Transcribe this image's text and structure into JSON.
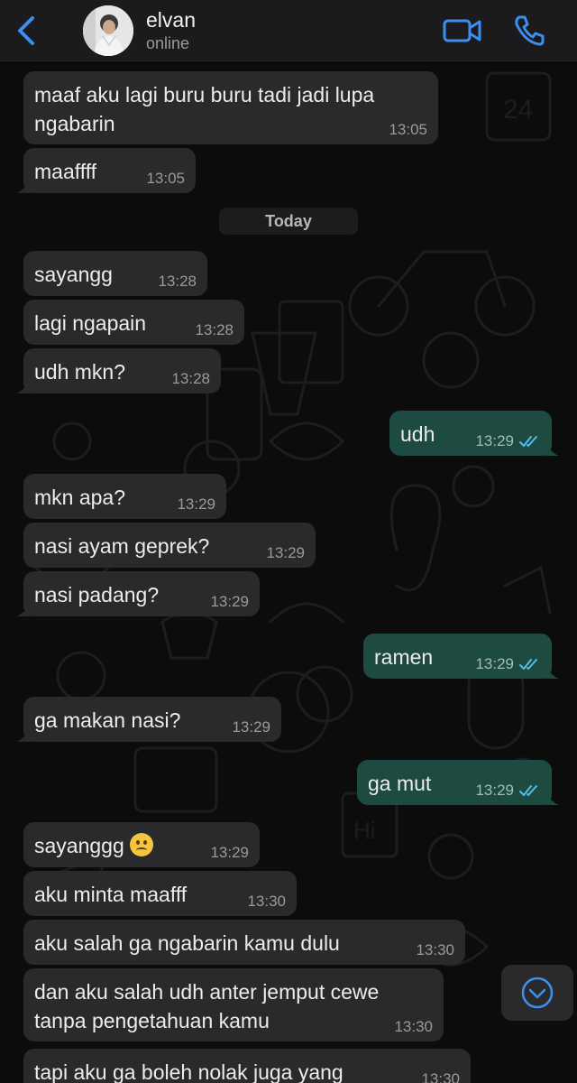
{
  "header": {
    "contact_name": "elvan",
    "status": "online",
    "accent_color": "#3b8ff0"
  },
  "date_separator": "Today",
  "messages": [
    {
      "dir": "in",
      "text": "maaf aku lagi buru buru tadi jadi lupa\nngabarin",
      "time": "13:05"
    },
    {
      "dir": "in",
      "text": "maaffff",
      "time": "13:05"
    },
    {
      "dir": "in",
      "text": "sayangg",
      "time": "13:28"
    },
    {
      "dir": "in",
      "text": "lagi ngapain",
      "time": "13:28"
    },
    {
      "dir": "in",
      "text": "udh mkn?",
      "time": "13:28"
    },
    {
      "dir": "out",
      "text": "udh",
      "time": "13:29",
      "status": "read"
    },
    {
      "dir": "in",
      "text": "mkn apa?",
      "time": "13:29"
    },
    {
      "dir": "in",
      "text": "nasi ayam geprek?",
      "time": "13:29"
    },
    {
      "dir": "in",
      "text": "nasi padang?",
      "time": "13:29"
    },
    {
      "dir": "out",
      "text": "ramen",
      "time": "13:29",
      "status": "read"
    },
    {
      "dir": "in",
      "text": "ga makan nasi?",
      "time": "13:29"
    },
    {
      "dir": "out",
      "text": "ga mut",
      "time": "13:29",
      "status": "read"
    },
    {
      "dir": "in",
      "text": "sayanggg",
      "emoji": "slightly-frowning-face",
      "time": "13:29"
    },
    {
      "dir": "in",
      "text": "aku minta maafff",
      "time": "13:30"
    },
    {
      "dir": "in",
      "text": "aku salah ga ngabarin kamu dulu",
      "time": "13:30"
    },
    {
      "dir": "in",
      "text": "dan aku salah udh anter jemput cewe\ntanpa pengetahuan kamu",
      "time": "13:30"
    },
    {
      "dir": "in",
      "text": "tapi aku ga boleh nolak juga yang",
      "time": "13:30"
    }
  ],
  "icons": {
    "back": "chevron-left-icon",
    "video": "video-camera-icon",
    "call": "phone-icon",
    "scroll": "chevron-down-circle-icon",
    "read_receipt": "double-check-icon"
  },
  "colors": {
    "incoming_bubble": "#2a2a2c",
    "outgoing_bubble": "#1d4a41",
    "read_check": "#53bdeb"
  }
}
